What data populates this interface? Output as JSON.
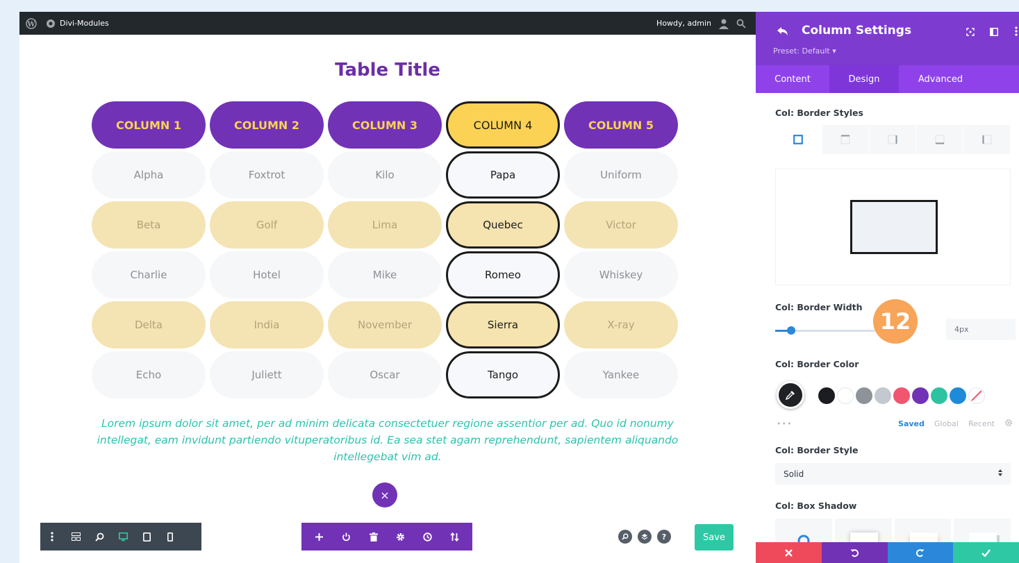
{
  "admin_bar": {
    "site_name": "Divi-Modules",
    "greeting": "Howdy, admin"
  },
  "canvas": {
    "table_title": "Table Title",
    "headers": [
      "COLUMN 1",
      "COLUMN 2",
      "COLUMN 3",
      "COLUMN 4",
      "COLUMN 5"
    ],
    "rows": [
      [
        "Alpha",
        "Foxtrot",
        "Kilo",
        "Papa",
        "Uniform"
      ],
      [
        "Beta",
        "Golf",
        "Lima",
        "Quebec",
        "Victor"
      ],
      [
        "Charlie",
        "Hotel",
        "Mike",
        "Romeo",
        "Whiskey"
      ],
      [
        "Delta",
        "India",
        "November",
        "Sierra",
        "X-ray"
      ],
      [
        "Echo",
        "Juliett",
        "Oscar",
        "Tango",
        "Yankee"
      ]
    ],
    "highlighted_column": 4,
    "lorem": "Lorem ipsum dolor sit amet, per ad minim delicata consectetuer regione assentior per ad. Quo id nonumy intellegat, eam invidunt partiendo vituperatoribus id. Ea sea stet agam reprehendunt, sapientem aliquando intellegebat vim ad.",
    "close_icon": "×"
  },
  "toolbars": {
    "left_icons": [
      "kebab-icon",
      "wireframe-icon",
      "zoom-icon",
      "desktop-icon",
      "tablet-icon",
      "phone-icon"
    ],
    "center_icons": [
      "add-icon",
      "power-icon",
      "trash-icon",
      "gear-icon",
      "history-icon",
      "sort-icon"
    ],
    "round_buttons": [
      "search",
      "layers",
      "?"
    ],
    "save_label": "Save"
  },
  "panel": {
    "title": "Column Settings",
    "preset": "Preset: Default ▾",
    "tabs": [
      "Content",
      "Design",
      "Advanced"
    ],
    "active_tab": "Design",
    "border_styles_label": "Col: Border Styles",
    "border_width_label": "Col: Border Width",
    "border_width_value": "4px",
    "border_width_fraction": 0.12,
    "badge": "12",
    "border_color_label": "Col: Border Color",
    "swatch_colors": [
      "#1b1d20",
      "#ffffff",
      "#8d9399",
      "#c3c9cf",
      "#f0566e",
      "#7132b6",
      "#2ec3a0",
      "#1f8ad8"
    ],
    "color_dots": "•••",
    "color_tabs": [
      "Saved",
      "Global",
      "Recent"
    ],
    "border_style_label": "Col: Border Style",
    "border_style_value": "Solid",
    "box_shadow_label": "Col: Box Shadow",
    "bottom_colors": [
      "#ef4a5c",
      "#7132b6",
      "#2b87da",
      "#2ec8a4"
    ]
  }
}
